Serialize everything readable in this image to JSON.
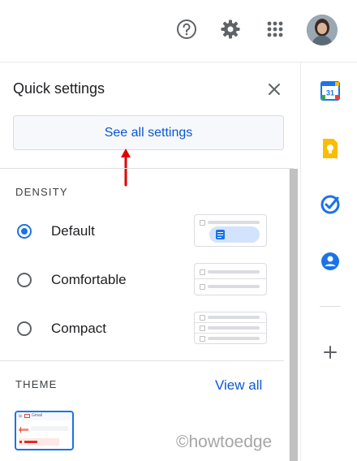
{
  "topbar": {
    "icons": [
      "help-icon",
      "settings-gear-icon",
      "apps-grid-icon"
    ],
    "avatar": "account-avatar"
  },
  "quick_settings": {
    "title": "Quick settings",
    "see_all_label": "See all settings"
  },
  "density": {
    "heading": "DENSITY",
    "options": [
      {
        "label": "Default",
        "selected": true
      },
      {
        "label": "Comfortable",
        "selected": false
      },
      {
        "label": "Compact",
        "selected": false
      }
    ]
  },
  "theme": {
    "heading": "THEME",
    "view_all_label": "View all",
    "thumbnail_label": "Gmail"
  },
  "side_panel": {
    "apps": [
      "calendar-icon",
      "keep-icon",
      "tasks-icon",
      "contacts-icon",
      "add-icon"
    ],
    "calendar_day": "31"
  },
  "watermark": "©howtoedge",
  "colors": {
    "accent": "#1a73e8",
    "link": "#0b57d0",
    "annotation_arrow": "#e00000",
    "calendar": "#1a73e8",
    "keep": "#fbbc04",
    "tasks": "#1a73e8",
    "contacts": "#1a73e8"
  }
}
